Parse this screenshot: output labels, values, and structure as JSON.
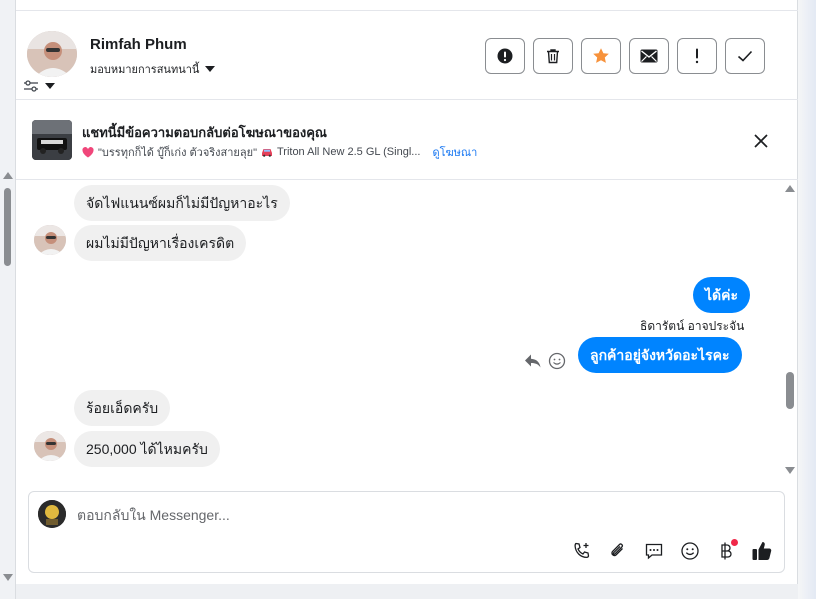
{
  "header": {
    "contact_name": "Rimfah Phum",
    "assign_label": "มอบหมายการสนทนานี้",
    "actions": [
      {
        "name": "spam-button",
        "icon": "alert-circle-icon"
      },
      {
        "name": "delete-button",
        "icon": "trash-icon"
      },
      {
        "name": "star-button",
        "icon": "star-icon"
      },
      {
        "name": "mark-unread-button",
        "icon": "envelope-icon"
      },
      {
        "name": "follow-up-button",
        "icon": "exclamation-icon"
      },
      {
        "name": "mark-done-button",
        "icon": "check-icon"
      }
    ]
  },
  "ad_bar": {
    "title": "แชทนี้มีข้อความตอบกลับต่อโฆษณาของคุณ",
    "quote": "\"บรรทุกก็ได้ บู๊ก็เก่ง ตัวจริงสายลุย\"",
    "product": "Triton All New 2.5 GL (Singl...",
    "link": "ดูโฆษณา"
  },
  "messages": {
    "m1": "จัดไฟแนนซ์ผมก็ไม่มีปัญหาอะไร",
    "m2": "ผมไม่มีปัญหาเรื่องเครดิต",
    "m3": "ได้ค่ะ",
    "sender": "ธิดารัตน์ อาจประจัน",
    "m4": "ลูกค้าอยู่จังหวัดอะไรคะ",
    "m5": "ร้อยเอ็ดครับ",
    "m6": "250,000 ได้ไหมครับ"
  },
  "composer": {
    "placeholder": "ตอบกลับใน Messenger...",
    "tools": [
      "phone-plus-icon",
      "paperclip-icon",
      "chat-bubble-icon",
      "smiley-icon",
      "baht-icon",
      "thumbs-up-icon"
    ]
  },
  "colors": {
    "accent": "#0084ff",
    "star": "#f7923b",
    "incoming_bubble": "#f0f0f0",
    "notification": "#f02849"
  }
}
